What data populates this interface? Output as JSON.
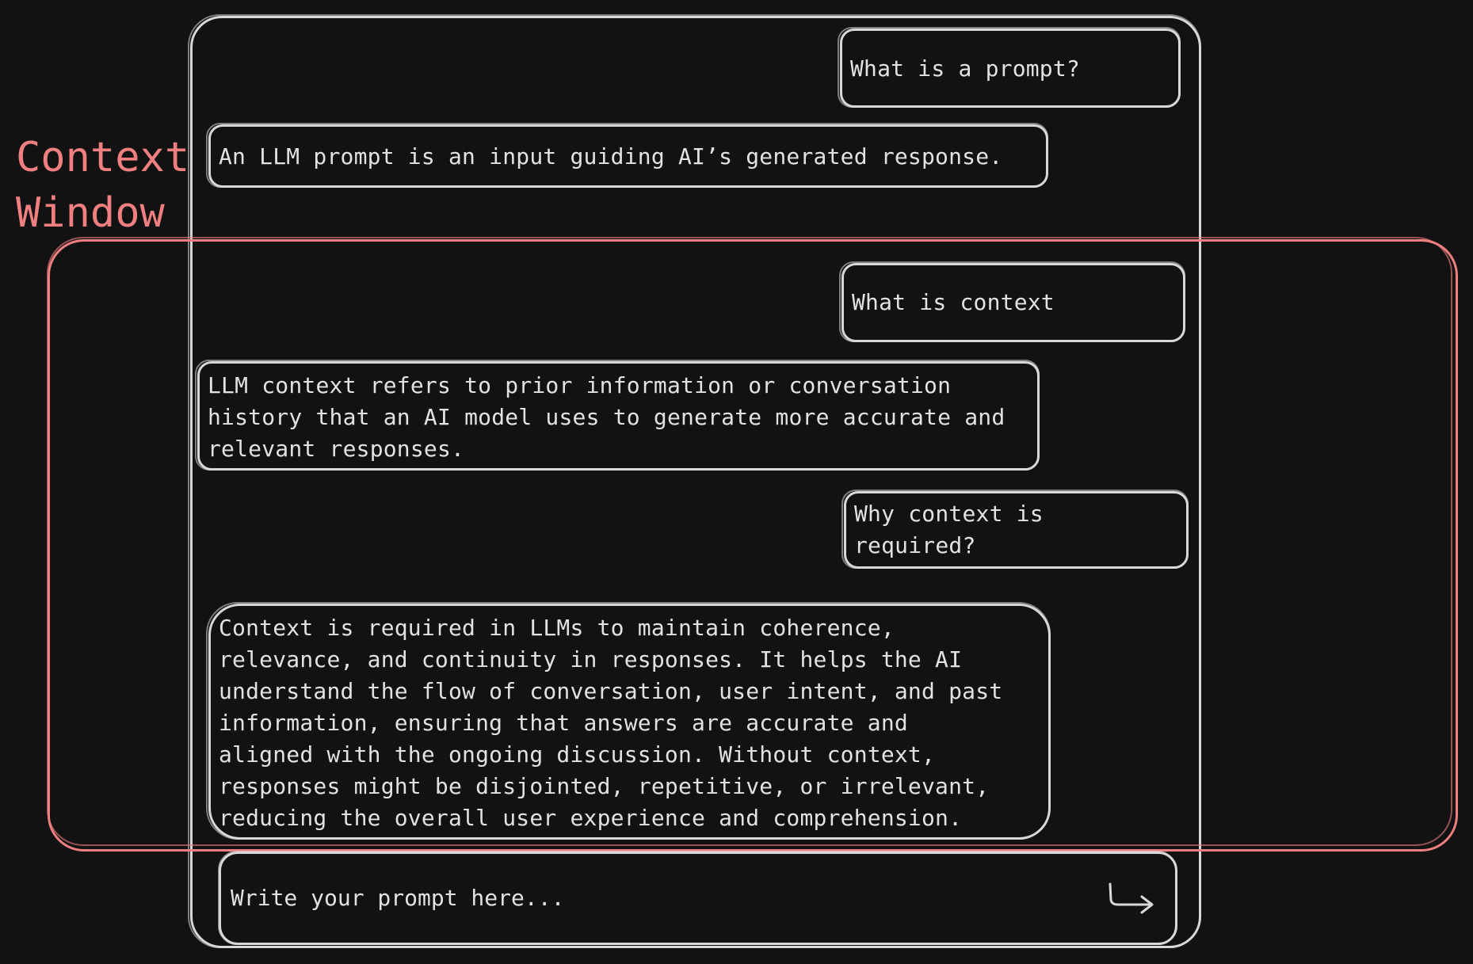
{
  "labels": {
    "context_window": "Context\nWindow"
  },
  "messages": [
    {
      "role": "user",
      "text": "What is a prompt?"
    },
    {
      "role": "assistant",
      "text": "An LLM prompt is an input guiding AI’s generated response."
    },
    {
      "role": "user",
      "text": "What is context"
    },
    {
      "role": "assistant",
      "text": "LLM context refers to prior information or conversation\nhistory that an AI model uses to generate more accurate and\nrelevant responses."
    },
    {
      "role": "user",
      "text": "Why context is\nrequired?"
    },
    {
      "role": "assistant",
      "text": "Context is required in LLMs to maintain coherence,\nrelevance, and continuity in responses. It helps the AI\nunderstand the flow of conversation, user intent, and past\ninformation, ensuring that answers are accurate and\naligned with the ongoing discussion. Without context,\nresponses might be disjointed, repetitive, or irrelevant,\nreducing the overall user experience and comprehension."
    }
  ],
  "input": {
    "placeholder": "Write your prompt here..."
  },
  "colors": {
    "background": "#121212",
    "stroke": "#d8d8d8",
    "accent": "#f07f7f",
    "text": "#e2e2e2"
  },
  "icons": {
    "send": "send-arrow-icon"
  }
}
